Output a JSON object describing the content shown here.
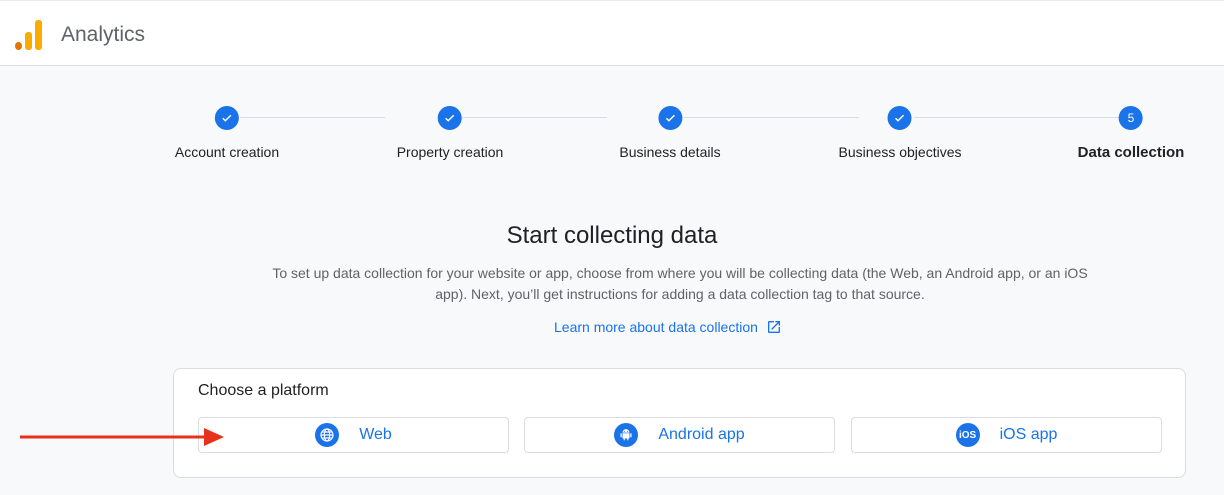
{
  "header": {
    "app_title": "Analytics",
    "logo_icon": "analytics-logo-icon"
  },
  "stepper": {
    "steps": [
      {
        "label": "Account creation",
        "state": "done"
      },
      {
        "label": "Property creation",
        "state": "done"
      },
      {
        "label": "Business details",
        "state": "done"
      },
      {
        "label": "Business objectives",
        "state": "done"
      },
      {
        "label": "Data collection",
        "state": "active",
        "number": "5"
      }
    ]
  },
  "main": {
    "title": "Start collecting data",
    "description": "To set up data collection for your website or app, choose from where you will be collecting data (the Web, an Android app, or an iOS app). Next, you’ll get instructions for adding a data collection tag to that source.",
    "learn_more": "Learn more about data collection"
  },
  "platform": {
    "title": "Choose a platform",
    "options": [
      {
        "label": "Web",
        "icon": "globe-icon"
      },
      {
        "label": "Android app",
        "icon": "android-icon"
      },
      {
        "label": "iOS app",
        "icon": "ios-icon",
        "icon_text": "iOS"
      }
    ]
  },
  "colors": {
    "accent": "#1a73e8",
    "annotation_arrow": "#e8311a"
  }
}
